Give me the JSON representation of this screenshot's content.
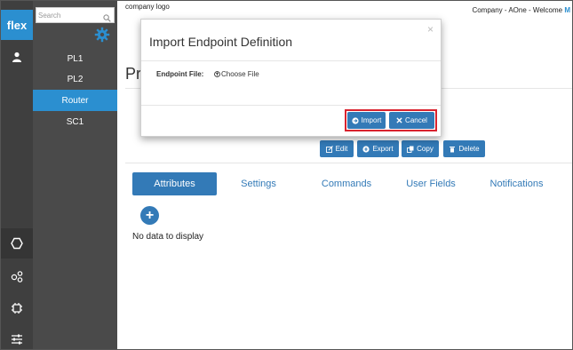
{
  "app": {
    "logo_text": "flex"
  },
  "rail": {
    "icons": [
      "user-icon",
      "hexagon-icon",
      "nodes-icon",
      "chip-icon",
      "sliders-icon"
    ]
  },
  "sidebar": {
    "search_placeholder": "Search",
    "items": [
      {
        "label": "PL1"
      },
      {
        "label": "PL2"
      },
      {
        "label": "Router",
        "active": true
      },
      {
        "label": "SC1"
      }
    ]
  },
  "header": {
    "company_logo": "company logo",
    "welcome_prefix": "Company - AOne - Welcome ",
    "welcome_user": "M"
  },
  "page": {
    "title_visible": "Pr",
    "actions": {
      "edit": "Edit",
      "export": "Export",
      "copy": "Copy",
      "delete": "Delete"
    },
    "tabs": [
      {
        "label": "Attributes",
        "active": true
      },
      {
        "label": "Settings"
      },
      {
        "label": "Commands"
      },
      {
        "label": "User Fields"
      },
      {
        "label": "Notifications"
      }
    ],
    "add_label": "+",
    "empty_text": "No data to display"
  },
  "modal": {
    "title": "Import Endpoint Definition",
    "close": "×",
    "field_label": "Endpoint File:",
    "choose_file": "Choose File",
    "import_label": "Import",
    "cancel_label": "Cancel"
  },
  "colors": {
    "accent": "#337ab7",
    "sidebar_active": "#2b8fd0",
    "highlight": "#d9232e",
    "rail": "#3f3f3f",
    "sidebar": "#4a4a4a"
  }
}
